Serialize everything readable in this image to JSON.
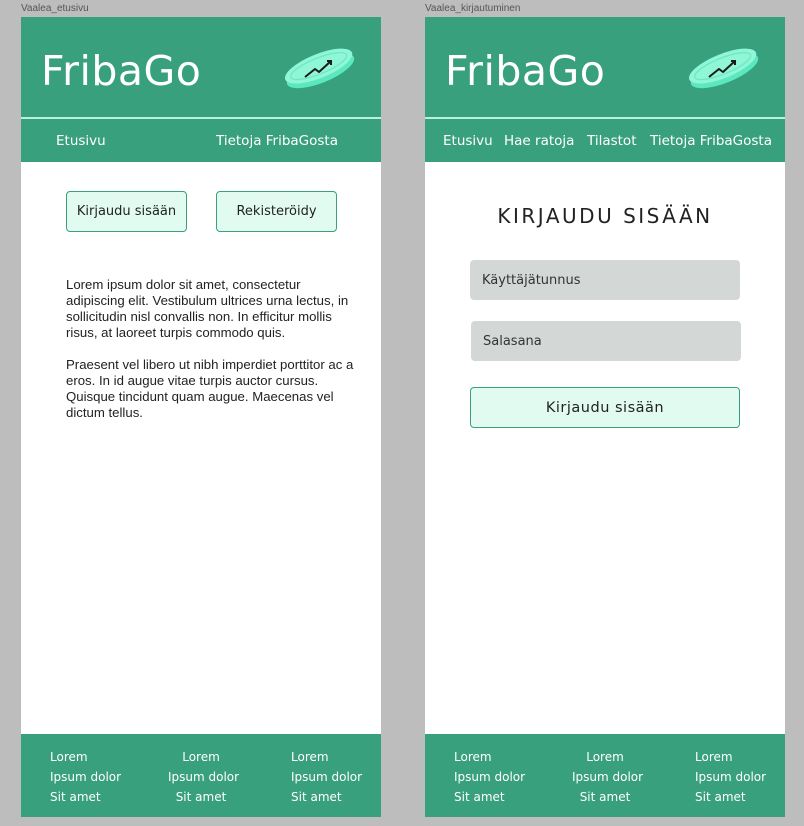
{
  "colors": {
    "brand_green": "#38a07c",
    "button_fill": "#e2fbf1",
    "field_fill": "#d3d8d6",
    "canvas": "#bdbdbd"
  },
  "frames": [
    {
      "label": "Vaalea_etusivu",
      "brand": "FribaGo",
      "logo_icon": "frisbee-icon",
      "nav": [
        "Etusivu",
        "Tietoja FribaGosta"
      ],
      "buttons": {
        "login": "Kirjaudu sisään",
        "register": "Rekisteröidy"
      },
      "paragraphs": [
        "Lorem ipsum dolor sit amet, consectetur adipiscing elit. Vestibulum ultrices urna lectus, in sollicitudin nisl convallis non. In efficitur mollis risus, at laoreet turpis commodo quis.",
        "Praesent vel libero ut nibh imperdiet porttitor ac a eros. In id augue vitae turpis auctor cursus. Quisque tincidunt quam augue. Maecenas vel dictum tellus."
      ],
      "footer": [
        [
          "Lorem",
          "Ipsum dolor",
          "Sit amet"
        ],
        [
          "Lorem",
          "Ipsum dolor",
          "Sit amet"
        ],
        [
          "Lorem",
          "Ipsum dolor",
          "Sit amet"
        ]
      ]
    },
    {
      "label": "Vaalea_kirjautuminen",
      "brand": "FribaGo",
      "logo_icon": "frisbee-icon",
      "nav": [
        "Etusivu",
        "Hae ratoja",
        "Tilastot",
        "Tietoja FribaGosta"
      ],
      "login": {
        "title": "KIRJAUDU SISÄÄN",
        "username_placeholder": "Käyttäjätunnus",
        "password_placeholder": "Salasana",
        "submit": "Kirjaudu sisään"
      },
      "footer": [
        [
          "Lorem",
          "Ipsum dolor",
          "Sit amet"
        ],
        [
          "Lorem",
          "Ipsum dolor",
          "Sit amet"
        ],
        [
          "Lorem",
          "Ipsum dolor",
          "Sit amet"
        ]
      ]
    }
  ]
}
